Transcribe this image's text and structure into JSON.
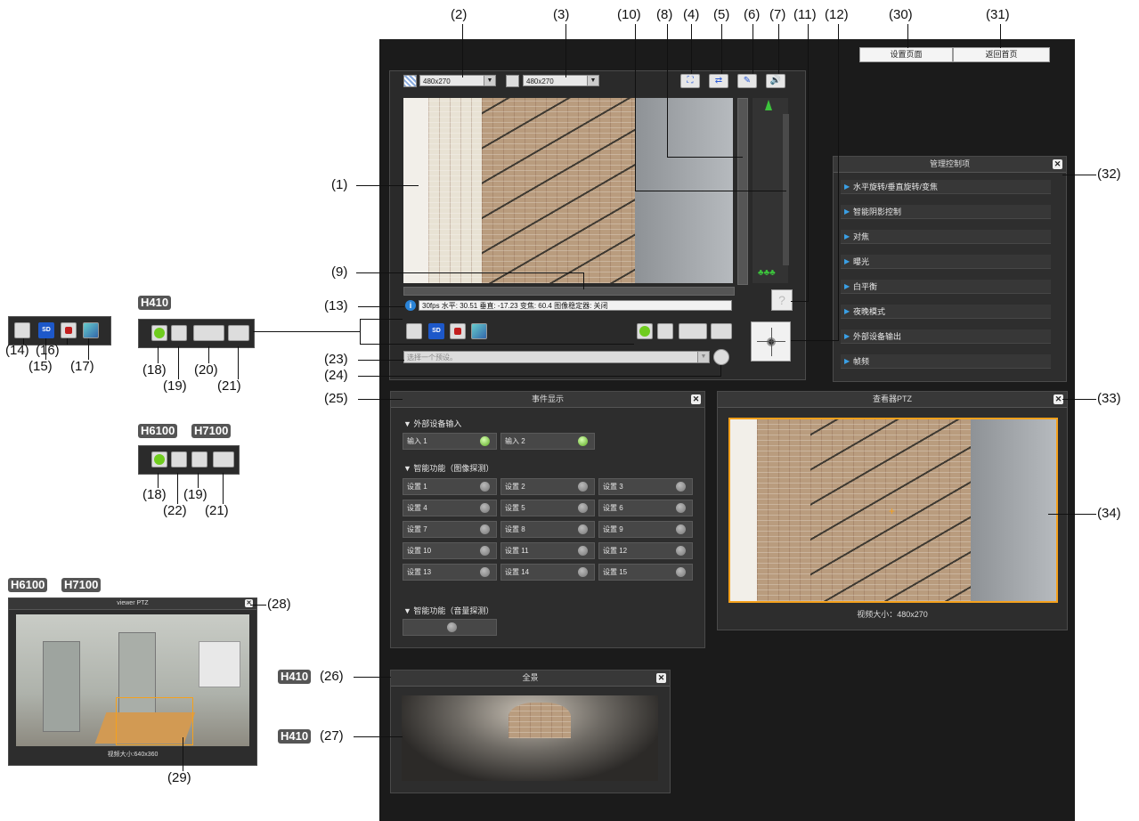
{
  "callouts": {
    "c1": "(1)",
    "c2": "(2)",
    "c3": "(3)",
    "c4": "(4)",
    "c5": "(5)",
    "c6": "(6)",
    "c7": "(7)",
    "c8": "(8)",
    "c9": "(9)",
    "c10": "(10)",
    "c11": "(11)",
    "c12": "(12)",
    "c13": "(13)",
    "c14": "(14)",
    "c15": "(15)",
    "c16": "(16)",
    "c17": "(17)",
    "c18": "(18)",
    "c19": "(19)",
    "c20": "(20)",
    "c21": "(21)",
    "c22": "(22)",
    "c23": "(23)",
    "c24": "(24)",
    "c25": "(25)",
    "c26": "(26)",
    "c27": "(27)",
    "c28": "(28)",
    "c29": "(29)",
    "c30": "(30)",
    "c31": "(31)",
    "c32": "(32)",
    "c33": "(33)",
    "c34": "(34)"
  },
  "badges": {
    "h410": "H410",
    "h6100": "H6100",
    "h7100": "H7100"
  },
  "top_buttons": {
    "settings": "设置页面",
    "home": "返回首页"
  },
  "viewer": {
    "receive_size": "480x270",
    "display_size": "480x270",
    "info_text": "30fps 水平: 30.51 垂直: -17.23 变焦: 60.4 图像稳定器: 关闭",
    "preset_placeholder": "选择一个预设。",
    "sd_label": "SD"
  },
  "admin_panel": {
    "title": "管理控制项",
    "items": [
      "水平旋转/垂直旋转/变焦",
      "智能阴影控制",
      "对焦",
      "曝光",
      "白平衡",
      "夜晚模式",
      "外部设备输出",
      "帧频"
    ]
  },
  "event_panel": {
    "title": "事件显示",
    "ext_input_heading": "▼ 外部设备输入",
    "inputs": [
      "输入 1",
      "输入 2"
    ],
    "image_detect_heading": "▼ 智能功能（图像探测）",
    "settings": [
      "设置 1",
      "设置 2",
      "设置 3",
      "设置 4",
      "设置 5",
      "设置 6",
      "设置 7",
      "设置 8",
      "设置 9",
      "设置 10",
      "设置 11",
      "设置 12",
      "设置 13",
      "设置 14",
      "设置 15"
    ],
    "audio_detect_heading": "▼ 智能功能（音量探测）"
  },
  "ptz_panel": {
    "title": "查看器PTZ",
    "video_size": "视频大小：480x270"
  },
  "panorama_panel": {
    "title": "全景"
  },
  "small_ptz_panel": {
    "title": "viewer PTZ",
    "video_size": "视频大小:640x360"
  }
}
